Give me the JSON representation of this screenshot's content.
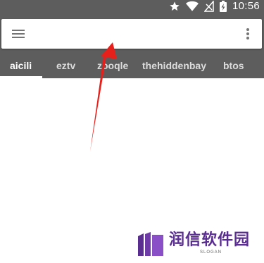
{
  "status_bar": {
    "time": "10:56",
    "icons": [
      "star-icon",
      "wifi-icon",
      "signal-off-icon",
      "battery-charging-icon"
    ]
  },
  "search": {
    "value": "",
    "placeholder": "",
    "menu_icon": "hamburger-menu-icon",
    "overflow_icon": "more-vert-icon"
  },
  "tabs": [
    {
      "label": "aicili",
      "active": true
    },
    {
      "label": "eztv",
      "active": false
    },
    {
      "label": "zooqle",
      "active": false
    },
    {
      "label": "thehiddenbay",
      "active": false
    },
    {
      "label": "btos",
      "active": false
    }
  ],
  "annotation": {
    "arrow_color": "#e8201c"
  },
  "watermark": {
    "text": "润信软件园",
    "slogan": "SLOGAN",
    "brand_color": "#5a2d91"
  },
  "colors": {
    "header": "#5d5d5d",
    "tab_active": "#ffffff",
    "tab_inactive": "#dcdcdc"
  }
}
